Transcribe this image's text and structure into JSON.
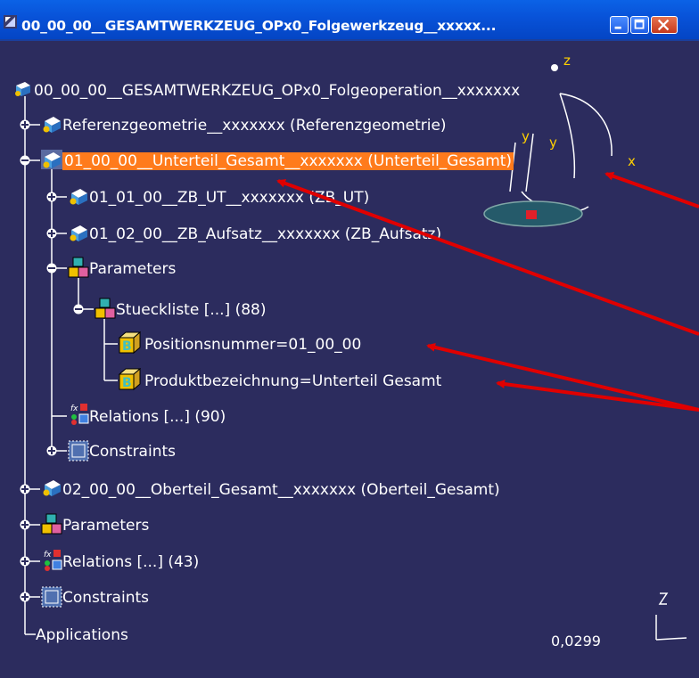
{
  "window": {
    "title": "00_00_00__GESAMTWERKZEUG_OPx0_Folgewerkzeug__xxxxx...",
    "controls": {
      "minimize": "minimize",
      "maximize": "maximize",
      "close": "close"
    }
  },
  "tree": {
    "root": "00_00_00__GESAMTWERKZEUG_OPx0_Folgeoperation__xxxxxxx",
    "ref": "Referenzgeometrie__xxxxxxx (Referenzgeometrie)",
    "ut_gesamt": "01_00_00__Unterteil_Gesamt__xxxxxxx (Unterteil_Gesamt)",
    "zb_ut": "01_01_00__ZB_UT__xxxxxxx (ZB_UT)",
    "zb_aufsatz": "01_02_00__ZB_Aufsatz__xxxxxxx (ZB_Aufsatz)",
    "parameters_1": "Parameters",
    "stueckliste": "Stueckliste [...] (88)",
    "positionsnummer": "Positionsnummer=01_00_00",
    "produktbezeichnung": "Produktbezeichnung=Unterteil Gesamt",
    "relations_1": "Relations [...] (90)",
    "constraints_1": "Constraints",
    "ot_gesamt": "02_00_00__Oberteil_Gesamt__xxxxxxx (Oberteil_Gesamt)",
    "parameters_2": "Parameters",
    "relations_2": "Relations [...] (43)",
    "constraints_2": "Constraints",
    "applications": "Applications"
  },
  "compass": {
    "z": "z",
    "y1": "y",
    "y2": "y",
    "x": "x"
  },
  "status": {
    "scale": "0,0299"
  },
  "colors": {
    "background": "#2c2c5e",
    "highlight": "#ff7b1c",
    "annotation_arrow": "#e00000"
  }
}
